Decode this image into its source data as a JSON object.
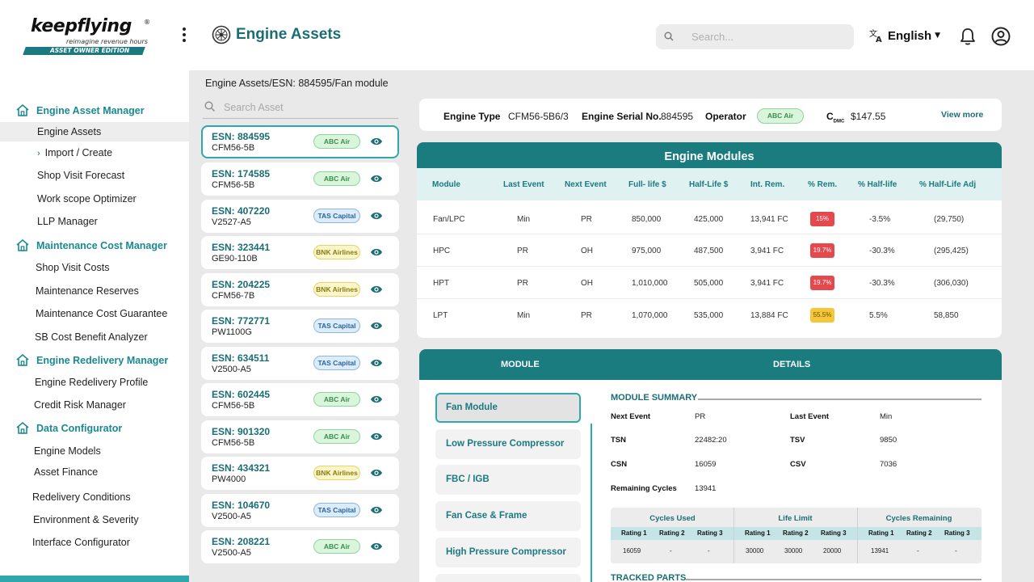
{
  "brand": {
    "name": "keepflying",
    "registered": "®",
    "tagline": "reimagine revenue hours",
    "edition": "ASSET OWNER EDITION"
  },
  "header": {
    "title": "Engine Assets",
    "search_placeholder": "Search...",
    "language": "English"
  },
  "sidebar": {
    "sections": [
      {
        "label": "Engine Asset Manager",
        "items": [
          "Engine Assets",
          "Import / Create",
          "Shop Visit Forecast",
          "Work scope Optimizer",
          "LLP Manager"
        ]
      },
      {
        "label": "Maintenance Cost Manager",
        "items": [
          "Shop Visit Costs",
          "Maintenance Reserves",
          "Maintenance Cost Guarantee",
          "SB Cost Benefit Analyzer"
        ]
      },
      {
        "label": "Engine Redelivery Manager",
        "items": [
          "Engine Redelivery Profile",
          "Credit Risk Manager"
        ]
      },
      {
        "label": "Data Configurator",
        "items": [
          "Engine Models",
          "Asset Finance",
          "Redelivery Conditions",
          "Environment & Severity",
          "Interface Configurator"
        ]
      }
    ]
  },
  "breadcrumb": "Engine Assets/ESN: 884595/Fan module",
  "asset_search_placeholder": "Search Asset",
  "assets": [
    {
      "esn": "ESN: 884595",
      "model": "CFM56-5B",
      "operator": "ABC Air"
    },
    {
      "esn": "ESN: 174585",
      "model": "CFM56-5B",
      "operator": "ABC Air"
    },
    {
      "esn": "ESN: 407220",
      "model": "V2527-A5",
      "operator": "TAS Capital"
    },
    {
      "esn": "ESN: 323441",
      "model": "GE90-110B",
      "operator": "BNK Airlines"
    },
    {
      "esn": "ESN: 204225",
      "model": "CFM56-7B",
      "operator": "BNK Airlines"
    },
    {
      "esn": "ESN: 772771",
      "model": "PW1100G",
      "operator": "TAS Capital"
    },
    {
      "esn": "ESN: 634511",
      "model": "V2500-A5",
      "operator": "TAS Capital"
    },
    {
      "esn": "ESN: 602445",
      "model": "CFM56-5B",
      "operator": "ABC Air"
    },
    {
      "esn": "ESN: 901320",
      "model": "CFM56-5B",
      "operator": "ABC Air"
    },
    {
      "esn": "ESN: 434321",
      "model": "PW4000",
      "operator": "BNK Airlines"
    },
    {
      "esn": "ESN: 104670",
      "model": "V2500-A5",
      "operator": "TAS Capital"
    },
    {
      "esn": "ESN: 208221",
      "model": "V2500-A5",
      "operator": "ABC Air"
    }
  ],
  "engine_info": {
    "type_label": "Engine Type",
    "type_value": "CFM56-5B6/3",
    "serial_label": "Engine Serial No.",
    "serial_value": "884595",
    "operator_label": "Operator",
    "operator_value": "ABC Air",
    "cdmc_c": "C",
    "cdmc_sub": "DMC",
    "cdmc_value": "$147.55",
    "view_more": "View more"
  },
  "engine_modules": {
    "title": "Engine Modules",
    "columns": [
      "Module",
      "Last Event",
      "Next Event",
      "Full- life $",
      "Half-Life $",
      "Int. Rem.",
      "% Rem.",
      "% Half-life",
      "% Half-Life Adj"
    ],
    "rows": [
      [
        "Fan/LPC",
        "Min",
        "PR",
        "850,000",
        "425,000",
        "13,941 FC",
        "15%",
        "-3.5%",
        "(29,750)"
      ],
      [
        "HPC",
        "PR",
        "OH",
        "975,000",
        "487,500",
        "3,941 FC",
        "19.7%",
        "-30.3%",
        "(295,425)"
      ],
      [
        "HPT",
        "PR",
        "OH",
        "1,010,000",
        "505,000",
        "3,941 FC",
        "19.7%",
        "-30.3%",
        "(306,030)"
      ],
      [
        "LPT",
        "Min",
        "PR",
        "1,070,000",
        "535,000",
        "13,884 FC",
        "55.5%",
        "5.5%",
        "58,850"
      ]
    ],
    "pct_status": [
      "red",
      "red",
      "red",
      "yellow"
    ]
  },
  "details_panel": {
    "module_header": "MODULE",
    "details_header": "DETAILS",
    "modules": [
      "Fan Module",
      "Low Pressure Compressor",
      "FBC / IGB",
      "Fan Case & Frame",
      "High Pressure Compressor"
    ],
    "summary_title": "MODULE SUMMARY",
    "summary": {
      "next_event_label": "Next Event",
      "next_event": "PR",
      "last_event_label": "Last Event",
      "last_event": "Min",
      "tsn_label": "TSN",
      "tsn": "22482:20",
      "tsv_label": "TSV",
      "tsv": "9850",
      "csn_label": "CSN",
      "csn": "16059",
      "csv_label": "CSV",
      "csv": "7036",
      "remaining_cycles_label": "Remaining Cycles",
      "remaining_cycles": "13941"
    },
    "cycles_table": {
      "groups": [
        "Cycles Used",
        "Life Limit",
        "Cycles Remaining"
      ],
      "rating_labels": [
        "Rating 1",
        "Rating 2",
        "Rating 3"
      ],
      "cycles_used": [
        "16059",
        "-",
        "-"
      ],
      "life_limit": [
        "30000",
        "30000",
        "20000"
      ],
      "cycles_remaining": [
        "13941",
        "-",
        "-"
      ]
    },
    "tracked_parts_title": "TRACKED PARTS"
  },
  "colors": {
    "teal": "#1b7c80",
    "teal_light": "#2fa7ac",
    "badge_green": "#3b8e49",
    "badge_blue": "#2a64a0",
    "badge_yellow": "#8a7a10",
    "pct_red": "#e5484d",
    "pct_yellow": "#f5c53a"
  }
}
